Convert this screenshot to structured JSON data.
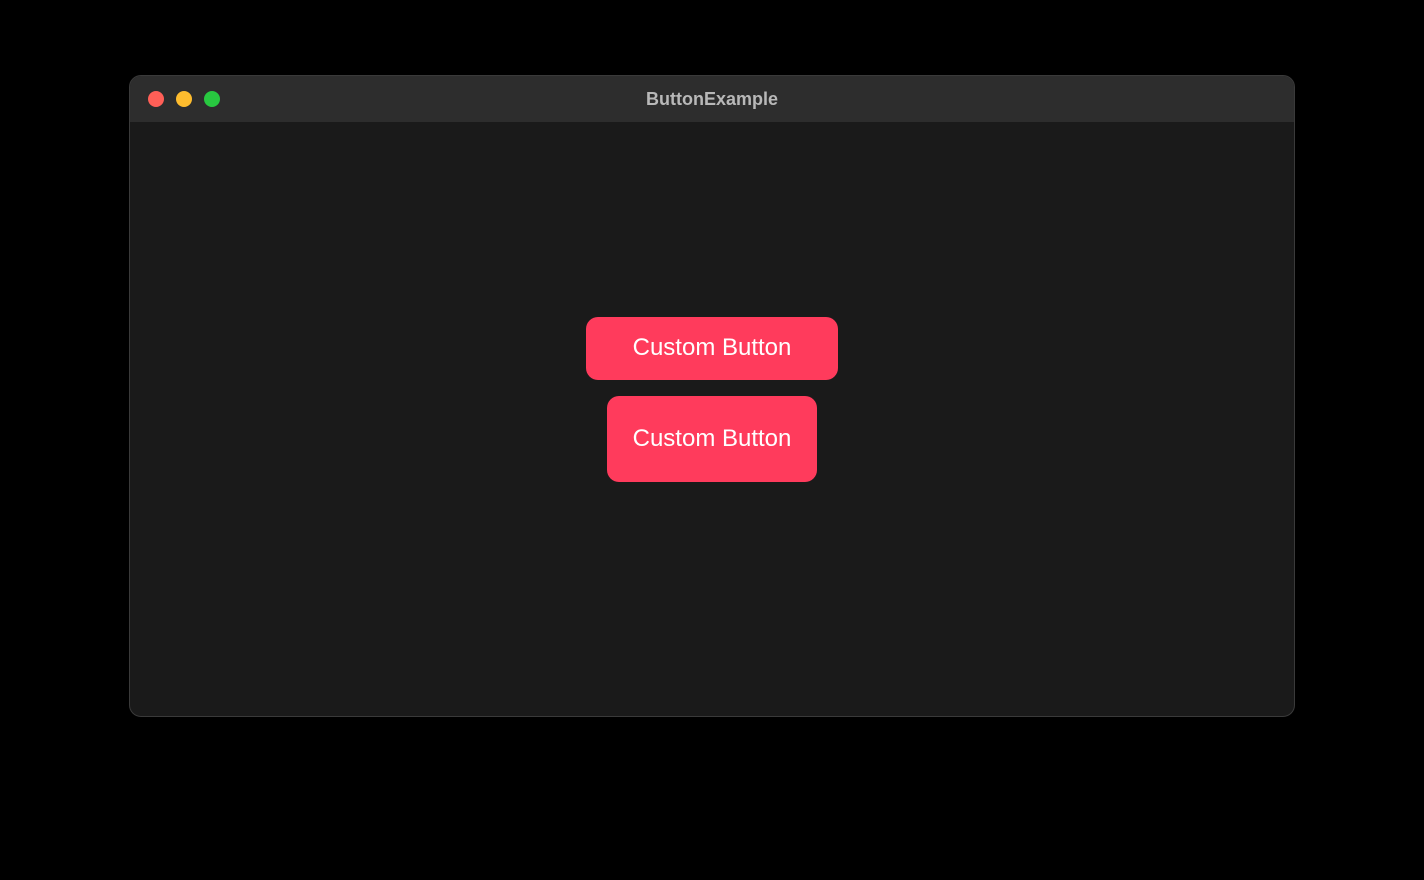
{
  "window": {
    "title": "ButtonExample"
  },
  "buttons": {
    "button1": {
      "label": "Custom Button"
    },
    "button2": {
      "label": "Custom Button"
    }
  },
  "colors": {
    "button_background": "#ff3b5c",
    "window_background": "#1a1a1a",
    "titlebar_background": "#2d2d2d"
  }
}
